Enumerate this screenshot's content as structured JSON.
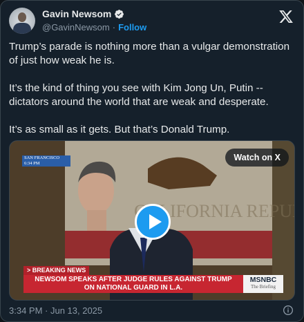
{
  "author": {
    "name": "Gavin Newsom",
    "handle": "@GavinNewsom",
    "separator": "·",
    "follow_label": "Follow"
  },
  "post": {
    "text": "Trump’s parade is nothing more than a vulgar demonstration of just how weak he is.\n\nIt’s the kind of thing you see with Kim Jong Un, Putin -- dictators around the world that are weak and desperate.\n\nIt’s as small as it gets. But that’s Donald Trump.",
    "timestamp": "3:34 PM · Jun 13, 2025"
  },
  "media": {
    "watch_label": "Watch on X",
    "location_bug": "SAN FRANCISCO\n6:34 PM",
    "breaking_label": "> BREAKING NEWS",
    "headline": "NEWSOM SPEAKS AFTER JUDGE RULES AGAINST TRUMP ON NATIONAL GUARD IN L.A.",
    "network": "MSNBC",
    "show": "The Briefing"
  },
  "icons": {
    "verified": "verified-badge-icon",
    "x_logo": "x-logo-icon",
    "play": "play-icon",
    "info": "info-icon"
  },
  "colors": {
    "background": "#15202b",
    "accent": "#1d9bf0",
    "text_primary": "#e7e9ea",
    "text_secondary": "#8b98a5",
    "banner_red": "#c72631"
  }
}
